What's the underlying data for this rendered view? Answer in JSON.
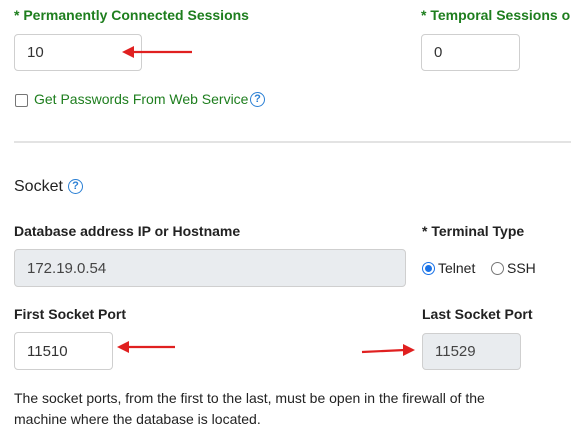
{
  "sessions": {
    "permanent_label": "* Permanently Connected Sessions",
    "permanent_value": "10",
    "temporal_label": "* Temporal Sessions on",
    "temporal_value": "0"
  },
  "web_service": {
    "checkbox_label": "Get Passwords From Web Service",
    "checked": false,
    "help_icon": "?"
  },
  "socket": {
    "title": "Socket",
    "help_icon": "?",
    "db_address_label": "Database address IP or Hostname",
    "db_address_value": "172.19.0.54",
    "terminal_type_label": "* Terminal Type",
    "terminal_options": [
      "Telnet",
      "SSH"
    ],
    "terminal_selected": "Telnet",
    "first_port_label": "First Socket Port",
    "first_port_value": "11510",
    "last_port_label": "Last Socket Port",
    "last_port_value": "11529",
    "note_line1": "The socket ports, from the first to the last, must be open in the firewall of the",
    "note_line2": "machine where the database is located."
  },
  "colors": {
    "label_green": "#1e7e1e",
    "arrow_red": "#e02020",
    "help_blue": "#2a7fd4",
    "radio_blue": "#1a73e8",
    "disabled_bg": "#e9ecef"
  },
  "annotations": {
    "arrows": [
      "arrow-left",
      "arrow-left",
      "arrow-left",
      "arrow-right"
    ]
  }
}
